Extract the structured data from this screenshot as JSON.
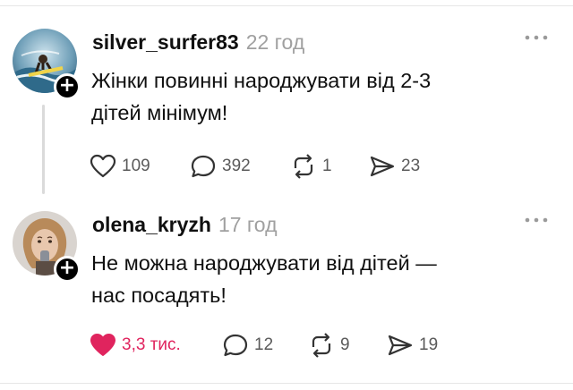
{
  "posts": [
    {
      "username": "silver_surfer83",
      "time": "22 год",
      "text_line1": "Жінки повинні народжувати від 2-3",
      "text_line2": "дітей мінімум!",
      "likes": "109",
      "liked": false,
      "comments": "392",
      "reposts": "1",
      "shares": "23",
      "avatar_icon": "surfer-avatar"
    },
    {
      "username": "olena_kryzh",
      "time": "17 год",
      "text_line1": "Не можна народжувати від дітей —",
      "text_line2": "нас посадять!",
      "likes": "3,3 тис.",
      "liked": true,
      "comments": "12",
      "reposts": "9",
      "shares": "19",
      "avatar_icon": "woman-avatar"
    }
  ],
  "icons": {
    "like": "heart-icon",
    "comment": "comment-bubble-icon",
    "repost": "repost-icon",
    "share": "share-send-icon",
    "more": "more-dots-icon",
    "follow": "plus-icon"
  },
  "colors": {
    "liked": "#e0245e",
    "muted": "#a0a0a0",
    "text": "#101010"
  }
}
